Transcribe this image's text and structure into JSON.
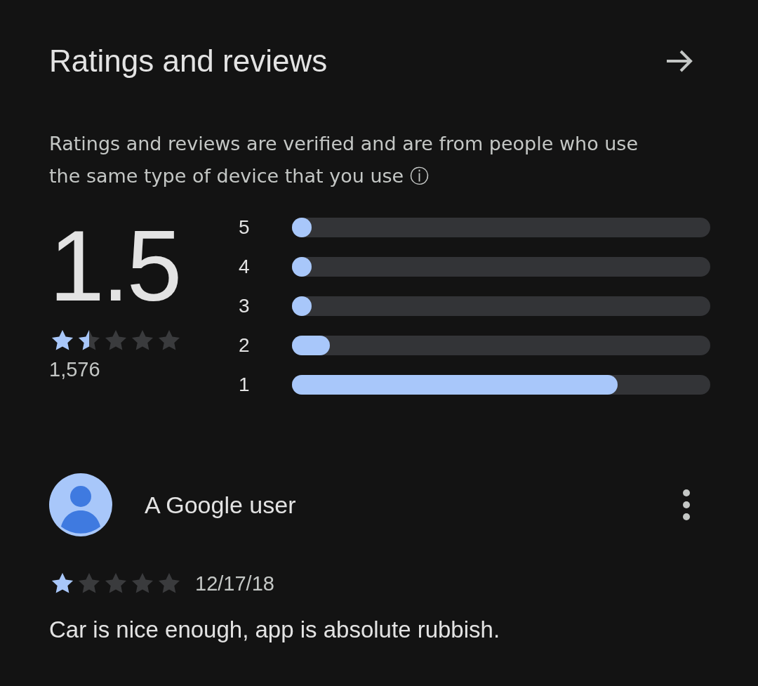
{
  "header": {
    "title": "Ratings and reviews"
  },
  "notice": "Ratings and reviews are verified and are from people who use the same type of device that you use ⓘ",
  "summary": {
    "score": "1.5",
    "stars": 1.5,
    "count": "1,576"
  },
  "distribution": [
    {
      "label": "5",
      "level": 0.047
    },
    {
      "label": "4",
      "level": 0.047
    },
    {
      "label": "3",
      "level": 0.047
    },
    {
      "label": "2",
      "level": 0.09
    },
    {
      "label": "1",
      "level": 0.778
    }
  ],
  "review": {
    "author": "A Google user",
    "stars": 1,
    "date": "12/17/18",
    "text": "Car is nice enough, app is absolute rubbish."
  }
}
